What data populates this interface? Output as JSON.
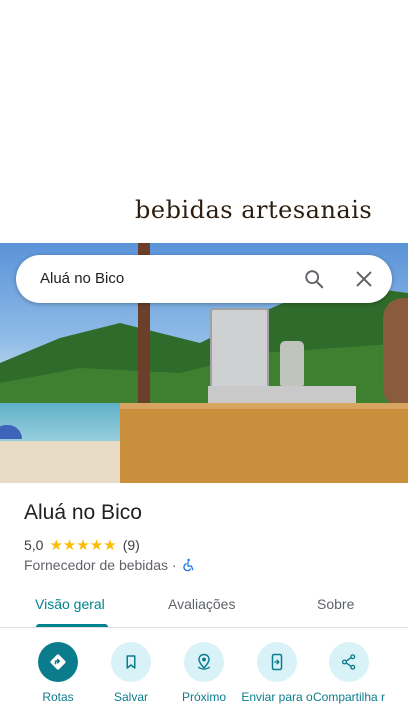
{
  "search": {
    "query": "Aluá no Bico"
  },
  "hero": {
    "sign_text": "bebidas artesanais"
  },
  "place": {
    "name": "Aluá no Bico",
    "rating": "5,0",
    "stars": "★★★★★",
    "review_count": "(9)",
    "category": "Fornecedor de bebidas",
    "separator": "·"
  },
  "tabs": [
    {
      "label": "Visão geral",
      "active": true
    },
    {
      "label": "Avaliações",
      "active": false
    },
    {
      "label": "Sobre",
      "active": false
    }
  ],
  "actions": [
    {
      "label": "Rotas",
      "icon": "directions-icon"
    },
    {
      "label": "Salvar",
      "icon": "bookmark-icon"
    },
    {
      "label": "Próximo",
      "icon": "nearby-icon"
    },
    {
      "label": "Enviar para o",
      "icon": "send-to-phone-icon"
    },
    {
      "label": "Compartilha r",
      "icon": "share-icon"
    }
  ],
  "colors": {
    "accent": "#00838f",
    "star": "#fbbc04",
    "action_bg": "#d9f2f7",
    "primary_action": "#0b7c8c"
  }
}
